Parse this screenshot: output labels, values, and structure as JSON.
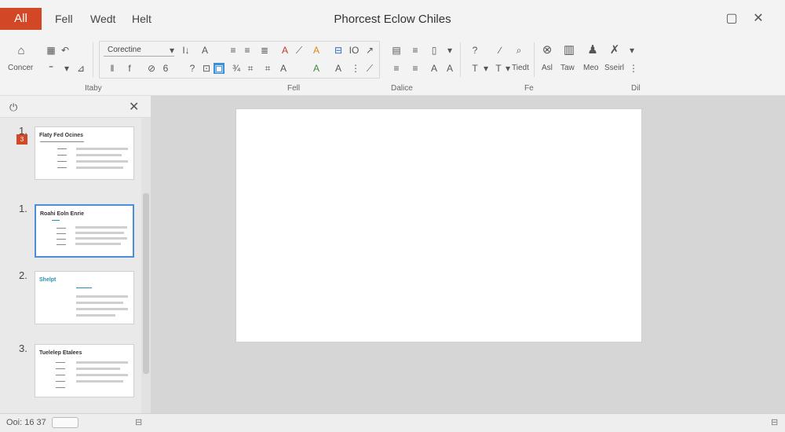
{
  "titlebar": {
    "file_tab": "All",
    "menu": [
      "Fell",
      "Wedt",
      "Helt"
    ],
    "title": "Phorcest Eclow Chiles",
    "restore_glyph": "▢",
    "close_glyph": "✕"
  },
  "ribbon": {
    "font_name": "Corectine",
    "big_button_label": "Concer",
    "right_labels": [
      "Asl",
      "Taw",
      "Meo",
      "Sseirl"
    ],
    "tiedt_label": "Tiedt",
    "group_labels": [
      "Itaby",
      "Fell",
      "Dalice",
      "Fe",
      "Dil"
    ],
    "glyphs_row1_left": [
      "⌂",
      "▦",
      "↶"
    ],
    "glyphs_font": [
      "I↓",
      "A",
      "A",
      "≡",
      "≡",
      "≣",
      "A",
      "⟋",
      "A",
      "⊟",
      "IO",
      "↗"
    ],
    "glyphs_row2_left": [
      "⁼",
      "▾",
      "⊿"
    ],
    "glyphs_font2": [
      "‖",
      "f",
      "⊘",
      "6",
      "?",
      "⊡",
      "▣",
      "¾",
      "⌗",
      "A",
      "A",
      "A",
      "⋮",
      "⟋"
    ],
    "glyphs_para": [
      "▤",
      "≡",
      "▯",
      "▾",
      "?",
      "∕",
      "⌕",
      "≡",
      "≡",
      "A",
      "A",
      "T",
      "▾",
      "T",
      "▾"
    ],
    "glyphs_right": [
      "⊗",
      "▥",
      "♟",
      "✗",
      "⋮"
    ]
  },
  "left_pane": {
    "pane_icon": "⏻",
    "close_glyph": "✕",
    "badge": "3",
    "slides": [
      {
        "number": "1.",
        "title": "Flaty Fed Ocines",
        "subtitle": ""
      },
      {
        "number": "1.",
        "title": "Roahi Eoln Enrie",
        "subtitle": ""
      },
      {
        "number": "2.",
        "title": "Shelpt",
        "subtitle": ""
      },
      {
        "number": "3.",
        "title": "Tuelelep Etalees",
        "subtitle": ""
      }
    ]
  },
  "statusbar": {
    "text": "Ooi: 16 37"
  },
  "colors": {
    "accent": "#d24726",
    "selection": "#4a90d9",
    "canvas_bg": "#d6d6d6"
  }
}
